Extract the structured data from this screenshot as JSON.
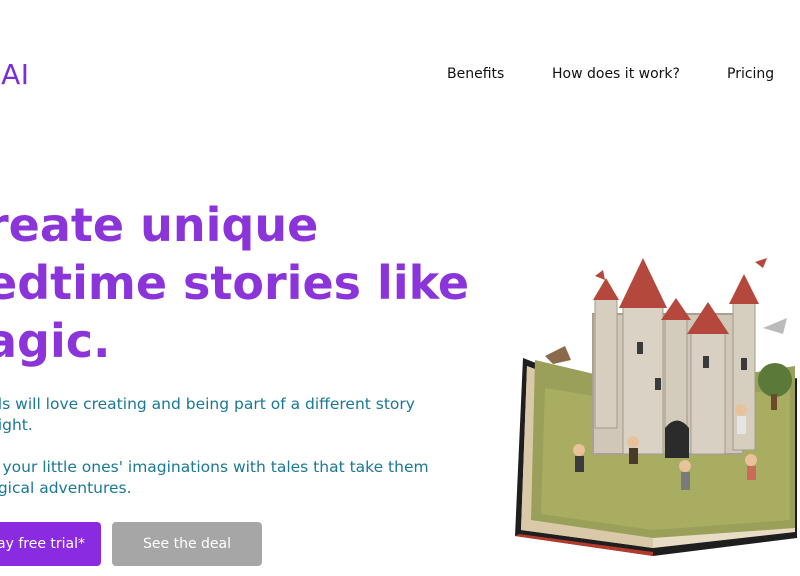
{
  "header": {
    "logo_text": "sAI",
    "nav": [
      {
        "label": "Benefits"
      },
      {
        "label": "How does it work?"
      },
      {
        "label": "Pricing"
      }
    ]
  },
  "hero": {
    "headline_lines": [
      "reate unique",
      "edtime stories like",
      "agic."
    ],
    "paragraphs": [
      [
        "ids will love creating and being part of a different story",
        "night."
      ],
      [
        "e your little ones' imaginations with tales that take them",
        "ugical adventures."
      ]
    ],
    "primary_button": "ay free trial*",
    "secondary_button": "See the deal"
  },
  "colors": {
    "brand": "#8a34d9",
    "text_teal": "#1a7896",
    "button_primary": "#8a2be2",
    "button_secondary": "#a6a6a6"
  }
}
